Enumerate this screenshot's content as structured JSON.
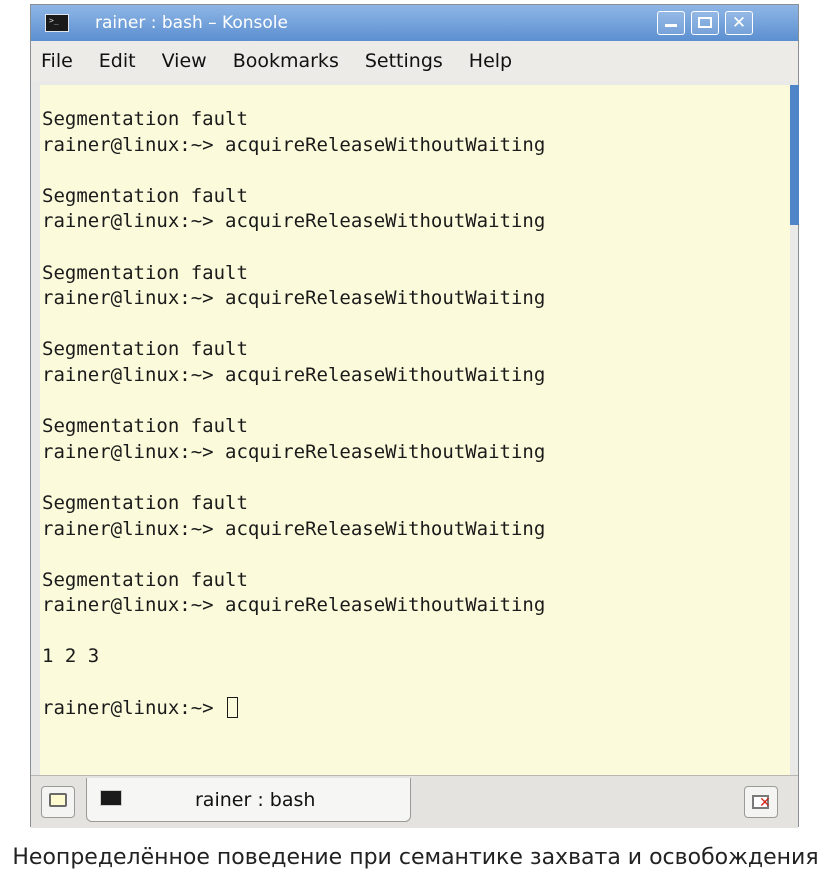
{
  "window": {
    "title": "rainer : bash – Konsole"
  },
  "menu": {
    "items": [
      "File",
      "Edit",
      "View",
      "Bookmarks",
      "Settings",
      "Help"
    ]
  },
  "terminal": {
    "lines": [
      "Segmentation fault",
      "rainer@linux:~> acquireReleaseWithoutWaiting",
      "",
      "Segmentation fault",
      "rainer@linux:~> acquireReleaseWithoutWaiting",
      "",
      "Segmentation fault",
      "rainer@linux:~> acquireReleaseWithoutWaiting",
      "",
      "Segmentation fault",
      "rainer@linux:~> acquireReleaseWithoutWaiting",
      "",
      "Segmentation fault",
      "rainer@linux:~> acquireReleaseWithoutWaiting",
      "",
      "Segmentation fault",
      "rainer@linux:~> acquireReleaseWithoutWaiting",
      "",
      "Segmentation fault",
      "rainer@linux:~> acquireReleaseWithoutWaiting",
      "",
      "1 2 3",
      ""
    ],
    "prompt": "rainer@linux:~> "
  },
  "tabs": {
    "active_label": "rainer : bash"
  },
  "caption": "Неопределённое поведение при семантике захвата и освобождения",
  "icons": {
    "app": "terminal-icon",
    "minimize": "minimize-icon",
    "maximize": "maximize-icon",
    "close": "close-icon",
    "new_tab": "new-tab-icon",
    "tab": "terminal-icon",
    "close_tab": "close-tab-icon"
  },
  "colors": {
    "titlebar": "#5b8fd0",
    "terminal_bg": "#fbfadb",
    "terminal_fg": "#1a1a1a"
  }
}
